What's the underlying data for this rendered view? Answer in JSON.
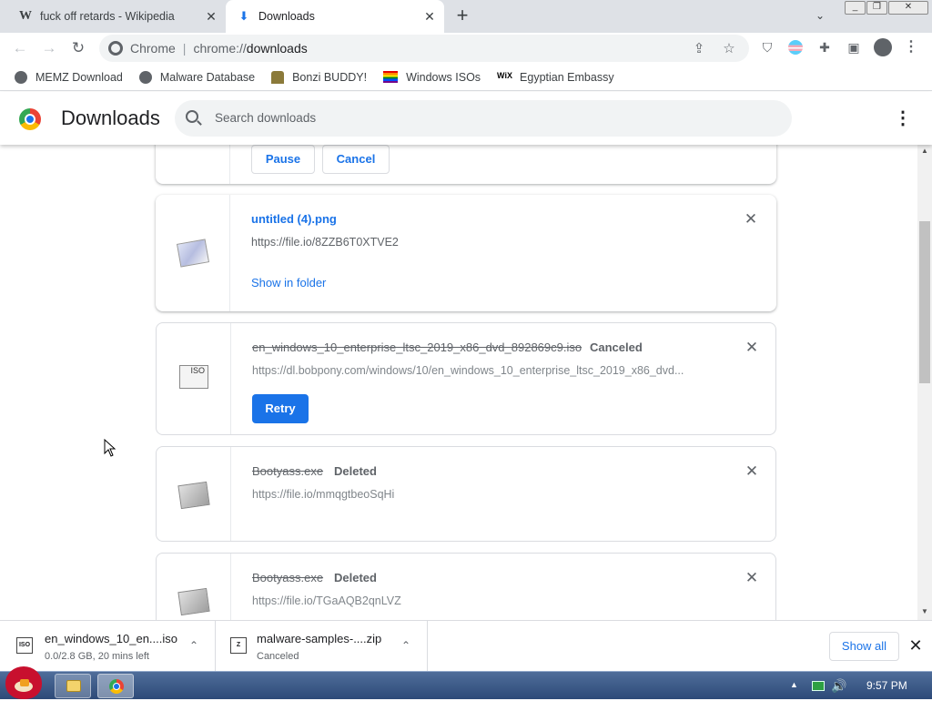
{
  "browser": {
    "tabs": [
      {
        "title": "fuck off retards - Wikipedia",
        "favicon": "wikipedia-w-icon"
      },
      {
        "title": "Downloads",
        "favicon": "download-arrow-icon",
        "active": true
      }
    ],
    "omnibox": {
      "scheme_label": "Chrome",
      "url_prefix": "chrome://",
      "url_host": "downloads"
    },
    "bookmarks": [
      {
        "label": "MEMZ Download",
        "icon": "globe-icon"
      },
      {
        "label": "Malware Database",
        "icon": "globe-icon"
      },
      {
        "label": "Bonzi BUDDY!",
        "icon": "bonzi-icon"
      },
      {
        "label": "Windows ISOs",
        "icon": "rainbow-flag-icon"
      },
      {
        "label": "Egyptian Embassy",
        "icon": "wix-icon"
      }
    ]
  },
  "downloads_page": {
    "title": "Downloads",
    "search_placeholder": "Search downloads",
    "partial_card": {
      "pause_label": "Pause",
      "cancel_label": "Cancel"
    },
    "items": [
      {
        "name": "untitled (4).png",
        "url": "https://file.io/8ZZB6T0XTVE2",
        "status": "",
        "action": "Show in folder",
        "icon": "png-file-icon"
      },
      {
        "name": "en_windows_10_enterprise_ltsc_2019_x86_dvd_892869c9.iso",
        "url": "https://dl.bobpony.com/windows/10/en_windows_10_enterprise_ltsc_2019_x86_dvd...",
        "status": "Canceled",
        "action": "Retry",
        "icon": "iso-file-icon"
      },
      {
        "name": "Bootyass.exe",
        "url": "https://file.io/mmqgtbeoSqHi",
        "status": "Deleted",
        "action": "",
        "icon": "exe-file-icon"
      },
      {
        "name": "Bootyass.exe",
        "url": "https://file.io/TGaAQB2qnLVZ",
        "status": "Deleted",
        "action": "",
        "icon": "exe-file-icon"
      }
    ]
  },
  "shelf": {
    "items": [
      {
        "name": "en_windows_10_en....iso",
        "sub": "0.0/2.8 GB, 20 mins left",
        "icon_label": "ISO"
      },
      {
        "name": "malware-samples-....zip",
        "sub": "Canceled",
        "icon_label": "Z"
      }
    ],
    "show_all": "Show all"
  },
  "taskbar": {
    "clock": "9:57 PM"
  },
  "colors": {
    "accent": "#1a73e8",
    "tabstrip": "#dee1e6",
    "taskbar": "#2d4a78"
  }
}
